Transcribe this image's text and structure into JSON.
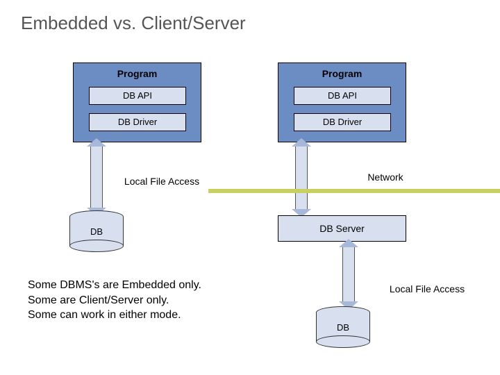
{
  "title": "Embedded vs. Client/Server",
  "left": {
    "program": "Program",
    "api": "DB API",
    "driver": "DB Driver",
    "access_label": "Local File Access",
    "db": "DB"
  },
  "right": {
    "program": "Program",
    "api": "DB API",
    "driver": "DB Driver",
    "network_label": "Network",
    "server": "DB Server",
    "access_label": "Local File Access",
    "db": "DB"
  },
  "footnote": {
    "l1": "Some DBMS's are Embedded only.",
    "l2": "Some are Client/Server only.",
    "l3": "Some can work in either mode."
  }
}
